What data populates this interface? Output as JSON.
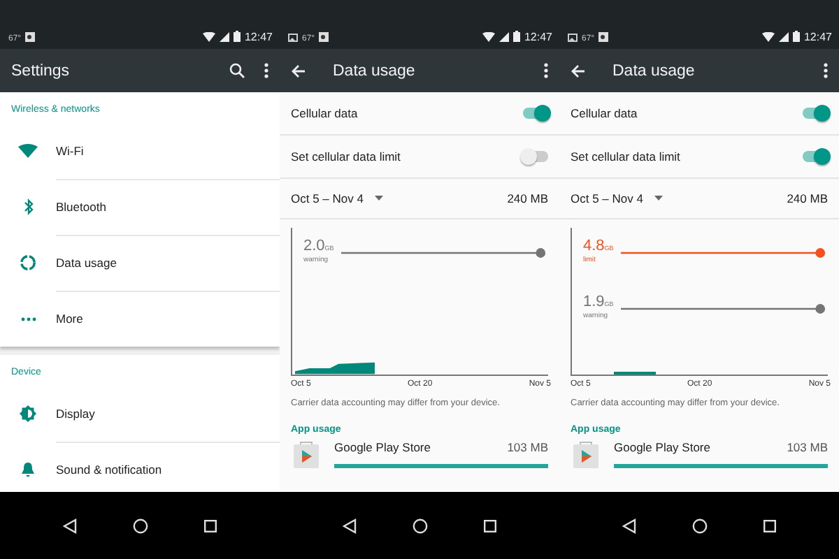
{
  "screens": [
    {
      "kind": "settings",
      "status": {
        "temp": "67°",
        "time": "12:47"
      },
      "title": "Settings",
      "sections": [
        {
          "header": "Wireless & networks",
          "card": true,
          "items": [
            {
              "label": "Wi‑Fi"
            },
            {
              "label": "Bluetooth"
            },
            {
              "label": "Data usage"
            },
            {
              "label": "More"
            }
          ]
        },
        {
          "header": "Device",
          "card": false,
          "items": [
            {
              "label": "Display"
            },
            {
              "label": "Sound & notification"
            }
          ]
        }
      ]
    },
    {
      "kind": "data_usage",
      "status": {
        "temp": "67°",
        "time": "12:47"
      },
      "title": "Data usage",
      "switches": [
        {
          "label": "Cellular data",
          "on": true
        },
        {
          "label": "Set cellular data limit",
          "on": false
        }
      ],
      "period": "Oct 5 – Nov 4",
      "total": "240 MB",
      "chart": {
        "lines": [
          {
            "kind": "warning",
            "value": "2.0",
            "unit": "GB",
            "label": "warning"
          }
        ],
        "x_labels": [
          "Oct 5",
          "Oct 20",
          "Nov 5"
        ]
      },
      "note": "Carrier data accounting may differ from your device.",
      "apps_header": "App usage",
      "apps": [
        {
          "name": "Google Play Store",
          "size": "103 MB"
        }
      ]
    },
    {
      "kind": "data_usage",
      "status": {
        "temp": "67°",
        "time": "12:47"
      },
      "title": "Data usage",
      "switches": [
        {
          "label": "Cellular data",
          "on": true
        },
        {
          "label": "Set cellular data limit",
          "on": true
        }
      ],
      "period": "Oct 5 – Nov 4",
      "total": "240 MB",
      "chart": {
        "lines": [
          {
            "kind": "limit",
            "value": "4.8",
            "unit": "GB",
            "label": "limit"
          },
          {
            "kind": "warning",
            "value": "1.9",
            "unit": "GB",
            "label": "warning"
          }
        ],
        "x_labels": [
          "Oct 5",
          "Oct 20",
          "Nov 5"
        ]
      },
      "note": "Carrier data accounting may differ from your device.",
      "apps_header": "App usage",
      "apps": [
        {
          "name": "Google Play Store",
          "size": "103 MB"
        }
      ]
    }
  ]
}
